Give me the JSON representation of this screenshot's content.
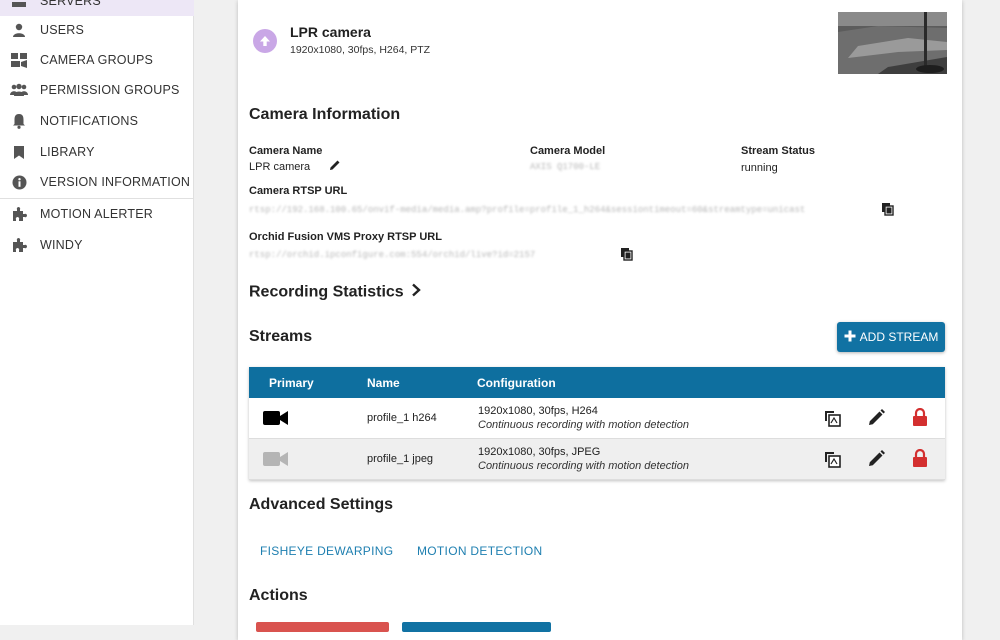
{
  "sidebar": {
    "items": [
      {
        "label": "SERVERS",
        "icon": "server-icon"
      },
      {
        "label": "USERS",
        "icon": "user-icon"
      },
      {
        "label": "CAMERA GROUPS",
        "icon": "camera-groups-icon"
      },
      {
        "label": "PERMISSION GROUPS",
        "icon": "people-icon"
      },
      {
        "label": "NOTIFICATIONS",
        "icon": "bell-icon"
      },
      {
        "label": "LIBRARY",
        "icon": "bookmark-icon"
      },
      {
        "label": "VERSION INFORMATION",
        "icon": "info-icon"
      },
      {
        "label": "MOTION ALERTER",
        "icon": "puzzle-icon"
      },
      {
        "label": "WINDY",
        "icon": "puzzle-icon"
      }
    ]
  },
  "camera": {
    "name": "LPR camera",
    "specs": "1920x1080, 30fps, H264, PTZ"
  },
  "info": {
    "heading": "Camera Information",
    "name_label": "Camera Name",
    "name_value": "LPR camera",
    "model_label": "Camera Model",
    "model_value": "AXIS Q1700-LE",
    "status_label": "Stream Status",
    "status_value": "running",
    "rtsp_label": "Camera RTSP URL",
    "rtsp_value": "rtsp://192.168.100.65/onvif-media/media.amp?profile=profile_1_h264&sessiontimeout=60&streamtype=unicast",
    "proxy_label": "Orchid Fusion VMS Proxy RTSP URL",
    "proxy_value": "rtsp://orchid.ipconfigure.com:554/orchid/live?id=2157"
  },
  "recording": {
    "heading": "Recording Statistics"
  },
  "streams": {
    "heading": "Streams",
    "add_label": "ADD STREAM",
    "columns": {
      "primary": "Primary",
      "name": "Name",
      "config": "Configuration"
    },
    "rows": [
      {
        "name": "profile_1 h264",
        "config": "1920x1080, 30fps, H264",
        "mode": "Continuous recording with motion detection",
        "primary": true
      },
      {
        "name": "profile_1 jpeg",
        "config": "1920x1080, 30fps, JPEG",
        "mode": "Continuous recording with motion detection",
        "primary": false
      }
    ]
  },
  "advanced": {
    "heading": "Advanced Settings",
    "fisheye": "FISHEYE DEWARPING",
    "motion": "MOTION DETECTION"
  },
  "actions": {
    "heading": "Actions"
  },
  "colors": {
    "accent": "#1172a3",
    "table_header": "#0e6f9f",
    "lock": "#d32f2f",
    "active_nav": "#ede7f6",
    "link": "#1e7fb0"
  }
}
